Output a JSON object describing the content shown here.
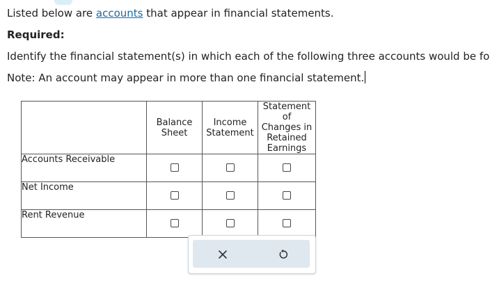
{
  "intro": {
    "before_link": "Listed below are ",
    "link_text": "accounts",
    "after_link": " that appear in financial statements."
  },
  "required_label": "Required:",
  "instruction": "Identify the financial statement(s) in which each of the following three accounts would be found.",
  "note": "Note: An account may appear in more than one financial statement.",
  "table": {
    "columns": [
      {
        "lines": [
          "Balance",
          "Sheet"
        ]
      },
      {
        "lines": [
          "Income",
          "Statement"
        ]
      },
      {
        "lines": [
          "Statement of",
          "Changes in",
          "Retained",
          "Earnings"
        ]
      }
    ],
    "rows": [
      {
        "label": "Accounts Receivable",
        "checked": [
          false,
          false,
          false
        ]
      },
      {
        "label": "Net Income",
        "checked": [
          false,
          false,
          false
        ]
      },
      {
        "label": "Rent Revenue",
        "checked": [
          false,
          false,
          false
        ]
      }
    ]
  },
  "buttons": {
    "clear_icon": "close-icon",
    "reset_icon": "reset-icon"
  },
  "colors": {
    "link": "#1a6aa6",
    "button_bar": "#dfe8ee",
    "border": "#555555"
  }
}
